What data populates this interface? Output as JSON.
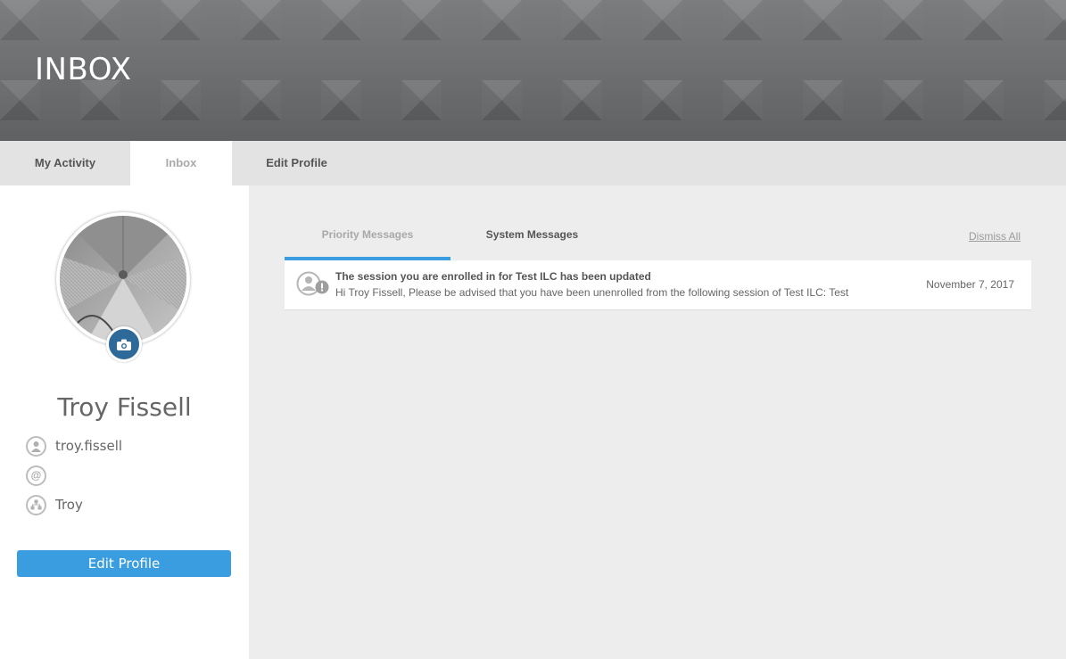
{
  "header": {
    "title": "INBOX"
  },
  "tabs": [
    {
      "label": "My Activity",
      "active": false
    },
    {
      "label": "Inbox",
      "active": true
    },
    {
      "label": "Edit Profile",
      "active": false
    }
  ],
  "profile": {
    "name": "Troy Fissell",
    "username": "troy.fissell",
    "email": "",
    "organization": "Troy",
    "edit_button_label": "Edit Profile"
  },
  "messages": {
    "tabs": [
      {
        "label": "Priority Messages",
        "active": true
      },
      {
        "label": "System Messages",
        "active": false
      }
    ],
    "dismiss_all_label": "Dismiss All",
    "items": [
      {
        "subject": "The session you are enrolled in for Test ILC has been updated",
        "preview": "Hi Troy Fissell, Please be advised that you have been unenrolled from the following session of Test ILC: Test",
        "date": "November 7, 2017"
      }
    ]
  },
  "colors": {
    "accent": "#3a9de0",
    "camera_button": "#2d6a9a",
    "banner": "#6f7173"
  }
}
